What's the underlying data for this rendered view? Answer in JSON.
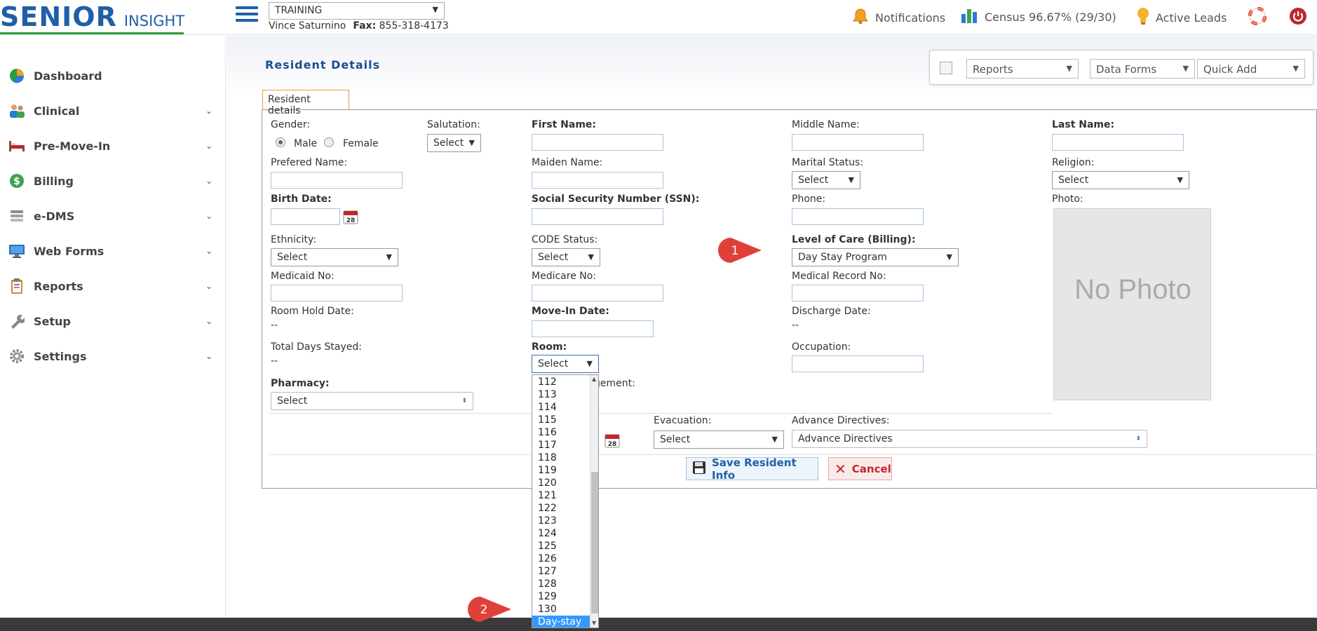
{
  "header": {
    "logo_main": "SENIOR",
    "logo_sub": "INSIGHT",
    "facility": "TRAINING",
    "user_name": "Vince Saturnino",
    "fax_label": "Fax:",
    "fax_number": "855-318-4173",
    "notifications": "Notifications",
    "census": "Census 96.67% (29/30)",
    "active_leads": "Active Leads"
  },
  "sidebar": {
    "items": [
      {
        "label": "Dashboard",
        "icon": "pie-chart-icon",
        "expandable": false
      },
      {
        "label": "Clinical",
        "icon": "users-icon",
        "expandable": true
      },
      {
        "label": "Pre-Move-In",
        "icon": "bed-icon",
        "expandable": true
      },
      {
        "label": "Billing",
        "icon": "dollar-icon",
        "expandable": true
      },
      {
        "label": "e-DMS",
        "icon": "documents-icon",
        "expandable": true
      },
      {
        "label": "Web Forms",
        "icon": "monitor-icon",
        "expandable": true
      },
      {
        "label": "Reports",
        "icon": "clipboard-icon",
        "expandable": true
      },
      {
        "label": "Setup",
        "icon": "wrench-icon",
        "expandable": true
      },
      {
        "label": "Settings",
        "icon": "gear-icon",
        "expandable": true
      }
    ]
  },
  "page": {
    "title": "Resident Details",
    "tab": "Resident details",
    "reports_select": "Reports",
    "data_forms_select": "Data Forms",
    "quick_add_select": "Quick Add"
  },
  "form": {
    "gender_label": "Gender:",
    "male": "Male",
    "female": "Female",
    "salutation_label": "Salutation:",
    "salutation_value": "Select",
    "first_name_label": "First Name:",
    "middle_name_label": "Middle Name:",
    "last_name_label": "Last Name:",
    "preferred_name_label": "Prefered Name:",
    "maiden_name_label": "Maiden Name:",
    "marital_status_label": "Marital Status:",
    "marital_status_value": "Select",
    "religion_label": "Religion:",
    "religion_value": "Select",
    "birth_date_label": "Birth Date:",
    "calendar_day": "28",
    "ssn_label": "Social Security Number (SSN):",
    "phone_label": "Phone:",
    "photo_label": "Photo:",
    "no_photo": "No Photo",
    "ethnicity_label": "Ethnicity:",
    "ethnicity_value": "Select",
    "code_status_label": "CODE Status:",
    "code_status_value": "Select",
    "level_of_care_label": "Level of Care (Billing):",
    "level_of_care_value": "Day Stay Program",
    "medicaid_label": "Medicaid No:",
    "medicare_label": "Medicare No:",
    "medical_record_label": "Medical Record No:",
    "room_hold_label": "Room Hold Date:",
    "room_hold_value": "--",
    "move_in_label": "Move-In Date:",
    "discharge_label": "Discharge Date:",
    "discharge_value": "--",
    "total_days_label": "Total Days Stayed:",
    "total_days_value": "--",
    "room_label": "Room:",
    "room_value": "Select",
    "occupation_label": "Occupation:",
    "pharmacy_label": "Pharmacy:",
    "pharmacy_value": "Select",
    "partial_label": "gement:",
    "evacuation_label": "Evacuation:",
    "evacuation_value": "Select",
    "advance_directives_label": "Advance Directives:",
    "advance_directives_value": "Advance Directives",
    "save_button": "Save Resident Info",
    "cancel_button": "Cancel"
  },
  "room_options": [
    "112",
    "113",
    "114",
    "115",
    "116",
    "117",
    "118",
    "119",
    "120",
    "121",
    "122",
    "123",
    "124",
    "125",
    "126",
    "127",
    "128",
    "129",
    "130",
    "Day-stay"
  ],
  "room_highlighted": "Day-stay",
  "callouts": [
    "1",
    "2"
  ],
  "colors": {
    "brand_blue": "#1f5fa8",
    "brand_green": "#2a9e3c",
    "callout_red": "#e0403a",
    "highlight_blue": "#3399ff"
  }
}
